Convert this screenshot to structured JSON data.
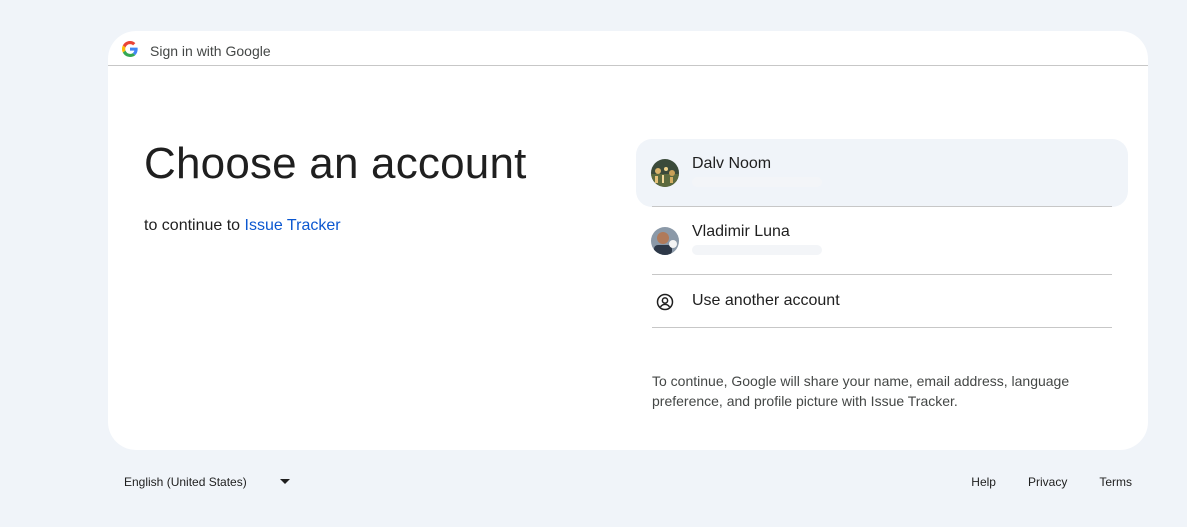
{
  "header": {
    "title": "Sign in with Google",
    "logo_icon": "google-g-logo"
  },
  "main": {
    "headline": "Choose an account",
    "subtitle_prefix": "to continue to",
    "app_name": "Issue Tracker"
  },
  "accounts": [
    {
      "name": "Dalv Noom",
      "avatar_icon": "avatar-photo",
      "selected": true
    },
    {
      "name": "Vladimir Luna",
      "avatar_icon": "avatar-photo",
      "selected": false
    }
  ],
  "use_another": {
    "label": "Use another account",
    "icon": "person-circle-icon"
  },
  "disclaimer": "To continue, Google will share your name, email address, language preference, and profile picture with Issue Tracker.",
  "footer": {
    "language": "English (United States)",
    "links": [
      "Help",
      "Privacy",
      "Terms"
    ]
  },
  "colors": {
    "background": "#f0f4f9",
    "link": "#0b57d0",
    "selected_row": "#f0f4f9"
  }
}
